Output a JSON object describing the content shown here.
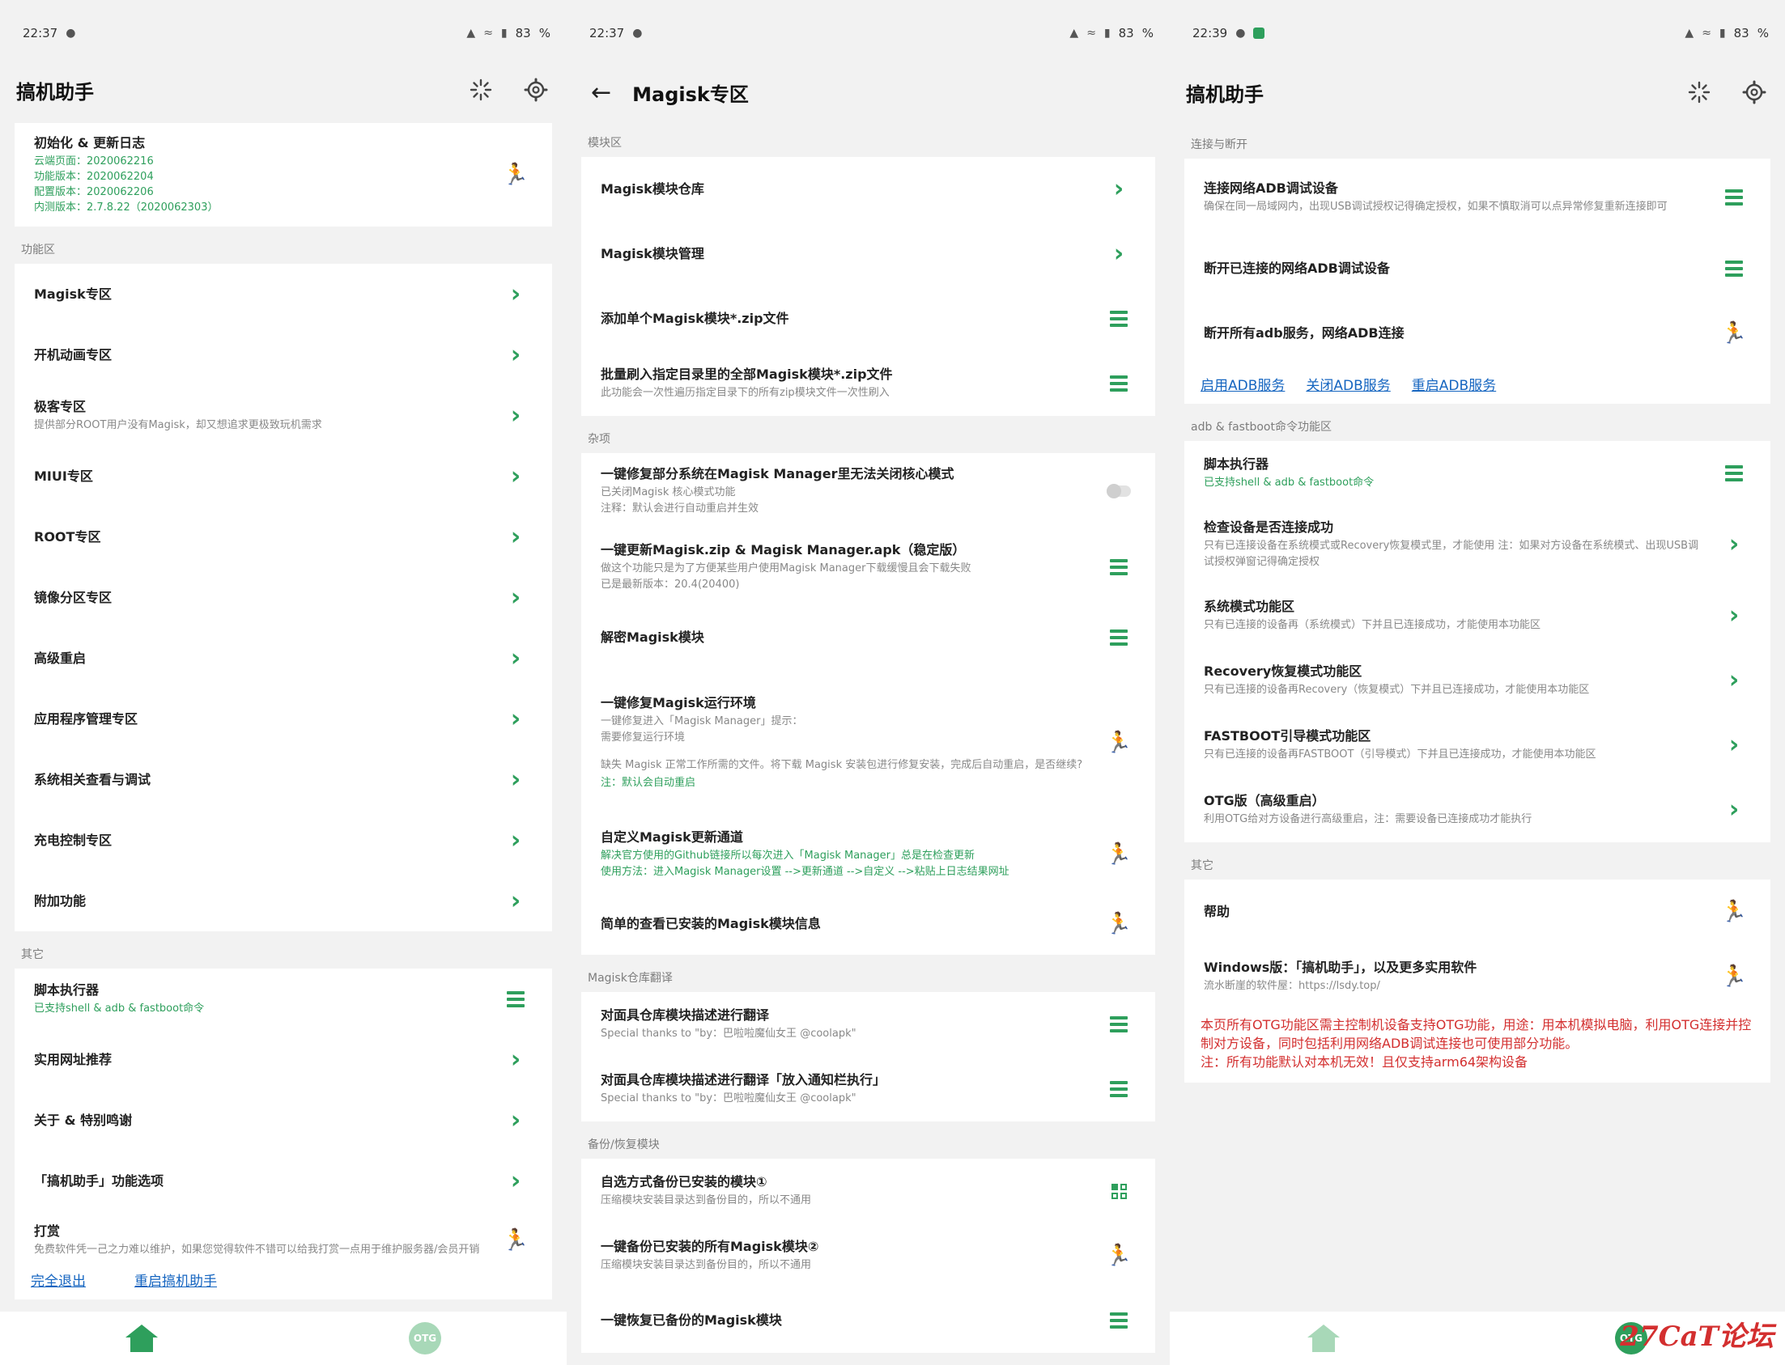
{
  "colors": {
    "accent": "#2e9f5c",
    "link": "#1565c0",
    "warning": "#d32f2f",
    "background": "#f2f2f2"
  },
  "status": {
    "p1": {
      "time": "22:37",
      "battery": "83"
    },
    "p2": {
      "time": "22:37",
      "battery": "83"
    },
    "p3": {
      "time": "22:39",
      "battery": "83"
    }
  },
  "p1": {
    "title": "搞机助手",
    "info": {
      "title": "初始化 & 更新日志",
      "lines": [
        "云端页面：2020062216",
        "功能版本：2020062204",
        "配置版本：2020062206",
        "内测版本：2.7.8.22（2020062303）"
      ]
    },
    "section_func": "功能区",
    "func_items": [
      {
        "title": "Magisk专区"
      },
      {
        "title": "开机动画专区"
      },
      {
        "title": "极客专区",
        "sub": "提供部分ROOT用户没有Magisk，却又想追求更极致玩机需求"
      },
      {
        "title": "MIUI专区"
      },
      {
        "title": "ROOT专区"
      },
      {
        "title": "镜像分区专区"
      },
      {
        "title": "高级重启"
      },
      {
        "title": "应用程序管理专区"
      },
      {
        "title": "系统相关查看与调试"
      },
      {
        "title": "充电控制专区"
      },
      {
        "title": "附加功能"
      }
    ],
    "section_other": "其它",
    "other_items": [
      {
        "title": "脚本执行器",
        "sub": "已支持shell & adb & fastboot命令"
      },
      {
        "title": "实用网址推荐"
      },
      {
        "title": "关于 & 特别鸣谢"
      },
      {
        "title": "「搞机助手」功能选项"
      },
      {
        "title": "打赏",
        "sub": "免费软件凭一己之力难以维护，如果您觉得软件不错可以给我打赏一点用于维护服务器/会员开销"
      }
    ],
    "link_exit": "完全退出",
    "link_restart": "重启搞机助手",
    "nav_otg": "OTG"
  },
  "p2": {
    "title": "Magisk专区",
    "section_module": "模块区",
    "module_items": [
      {
        "title": "Magisk模块仓库"
      },
      {
        "title": "Magisk模块管理"
      },
      {
        "title": "添加单个Magisk模块*.zip文件"
      },
      {
        "title": "批量刷入指定目录里的全部Magisk模块*.zip文件",
        "sub": "此功能会一次性遍历指定目录下的所有zip模块文件一次性刷入"
      }
    ],
    "section_misc": "杂项",
    "misc_items": [
      {
        "title": "一键修复部分系统在Magisk Manager里无法关闭核心模式",
        "sub1": "已关闭Magisk 核心模式功能",
        "sub2": "注释：默认会进行自动重启并生效"
      },
      {
        "title": "一键更新Magisk.zip & Magisk Manager.apk（稳定版）",
        "sub1": "做这个功能只是为了方便某些用户使用Magisk Manager下载缓慢且会下载失败",
        "sub2": "已是最新版本：20.4(20400)"
      },
      {
        "title": "解密Magisk模块"
      },
      {
        "title": "一键修复Magisk运行环境",
        "sub1": "一键修复进入「Magisk Manager」提示：",
        "sub2": "需要修复运行环境",
        "sub3": "缺失 Magisk 正常工作所需的文件。将下载 Magisk 安装包进行修复安装，完成后自动重启，是否继续?",
        "sub4": "注：默认会自动重启"
      },
      {
        "title": "自定义Magisk更新通道",
        "sub1": "解决官方使用的Github链接所以每次进入「Magisk Manager」总是在检查更新",
        "sub2": "使用方法：进入Magisk Manager设置 -->更新通道 -->自定义 -->粘贴上日志结果网址"
      },
      {
        "title": "简单的查看已安装的Magisk模块信息"
      }
    ],
    "section_translate": "Magisk仓库翻译",
    "translate_items": [
      {
        "title": "对面具仓库模块描述进行翻译",
        "sub": "Special thanks to \"by：巴啦啦魔仙女王 @coolapk\""
      },
      {
        "title": "对面具仓库模块描述进行翻译「放入通知栏执行」",
        "sub": "Special thanks to \"by：巴啦啦魔仙女王 @coolapk\""
      }
    ],
    "section_backup": "备份/恢复模块",
    "backup_items": [
      {
        "title": "自选方式备份已安装的模块①",
        "sub": "压缩模块安装目录达到备份目的，所以不通用"
      },
      {
        "title": "一键备份已安装的所有Magisk模块②",
        "sub": "压缩模块安装目录达到备份目的，所以不通用"
      },
      {
        "title": "一键恢复已备份的Magisk模块"
      }
    ]
  },
  "p3": {
    "title": "搞机助手",
    "section_conn": "连接与断开",
    "conn_items": [
      {
        "title": "连接网络ADB调试设备",
        "sub": "确保在同一局域网内，出现USB调试授权记得确定授权，如果不慎取消可以点异常修复重新连接即可"
      },
      {
        "title": "断开已连接的网络ADB调试设备"
      },
      {
        "title": "断开所有adb服务，网络ADB连接"
      }
    ],
    "links": [
      "启用ADB服务",
      "关闭ADB服务",
      "重启ADB服务"
    ],
    "section_adb": "adb & fastboot命令功能区",
    "adb_items": [
      {
        "title": "脚本执行器",
        "sub": "已支持shell & adb & fastboot命令"
      },
      {
        "title": "检查设备是否连接成功",
        "sub": "只有已连接设备在系统模式或Recovery恢复模式里，才能使用 注：如果对方设备在系统模式、出现USB调试授权弹窗记得确定授权"
      },
      {
        "title": "系统模式功能区",
        "sub": "只有已连接的设备再（系统模式）下并且已连接成功，才能使用本功能区"
      },
      {
        "title": "Recovery恢复模式功能区",
        "sub": "只有已连接的设备再Recovery（恢复模式）下并且已连接成功，才能使用本功能区"
      },
      {
        "title": "FASTBOOT引导模式功能区",
        "sub": "只有已连接的设备再FASTBOOT（引导模式）下并且已连接成功，才能使用本功能区"
      },
      {
        "title": "OTG版（高级重启）",
        "sub": "利用OTG给对方设备进行高级重启，注：需要设备已连接成功才能执行"
      }
    ],
    "section_other": "其它",
    "other_items": [
      {
        "title": "帮助"
      },
      {
        "title": "Windows版：「搞机助手」，以及更多实用软件",
        "sub": "流水断崖的软件屋：https://lsdy.top/"
      }
    ],
    "note_lines": [
      "本页所有OTG功能区需主控制机设备支持OTG功能，用途：用本机模拟电脑，利用OTG连接并控制对方设备，同时包括利用网络ADB调试连接也可使用部分功能。",
      "注：所有功能默认对本机无效！且仅支持arm64架构设备"
    ],
    "nav_otg": "OTG",
    "watermark": "27CaT论坛"
  }
}
